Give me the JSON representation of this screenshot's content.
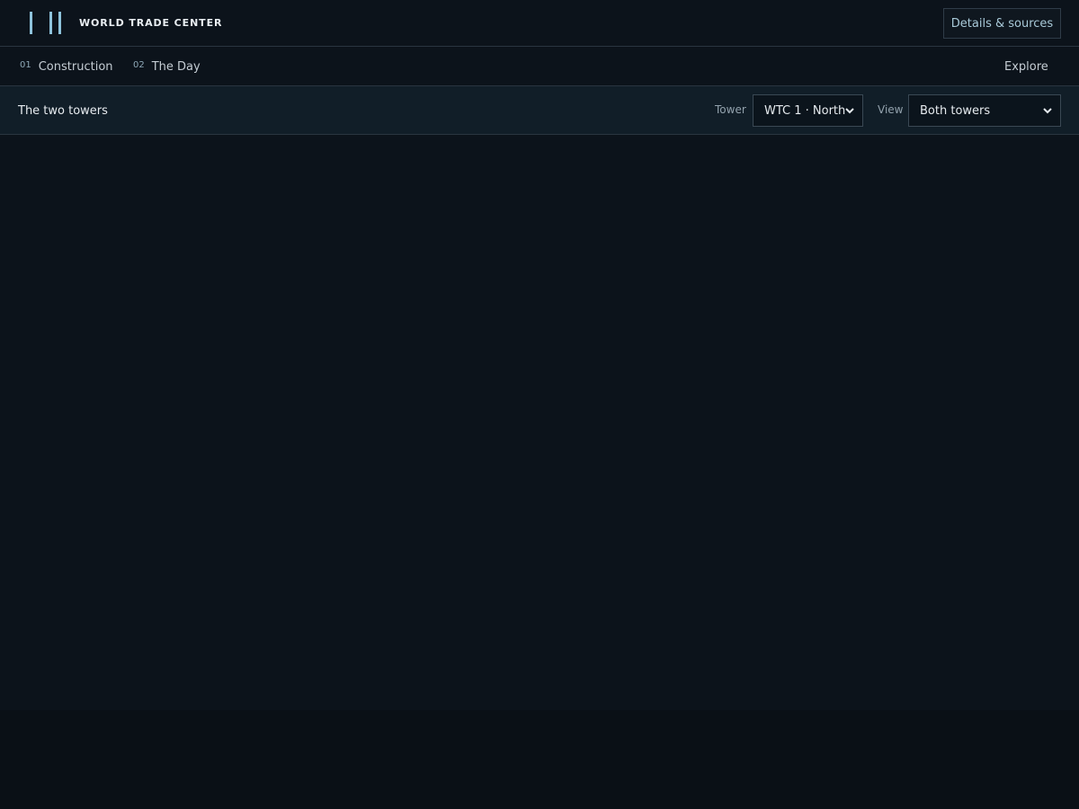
{
  "header": {
    "brand": "WORLD TRADE CENTER",
    "details_label": "Details & sources"
  },
  "nav": {
    "items": [
      {
        "num": "01",
        "label": "Construction"
      },
      {
        "num": "02",
        "label": "The Day"
      }
    ],
    "explore_label": "Explore"
  },
  "controls": {
    "section_title": "The two towers",
    "tower_label": "Tower",
    "tower_value": "WTC 1 · North",
    "view_label": "View",
    "view_value": "Both towers"
  },
  "colors": {
    "accent": "#8ec3dc",
    "background": "#0c131b",
    "subbar": "#111e28"
  }
}
